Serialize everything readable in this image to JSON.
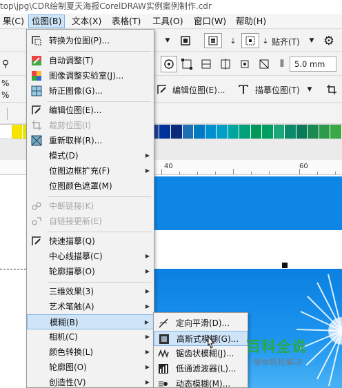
{
  "window": {
    "title": "top\\jpg\\CDR绘制夏天海报CorelDRAW实例案例制作.cdr"
  },
  "menubar": {
    "items": [
      {
        "label": "果(C)"
      },
      {
        "label": "位图(B)",
        "active": true
      },
      {
        "label": "文本(X)"
      },
      {
        "label": "表格(T)"
      },
      {
        "label": "工具(O)"
      },
      {
        "label": "窗口(W)"
      },
      {
        "label": "帮助(H)"
      }
    ]
  },
  "toolbar": {
    "snap_label": "贴齐(T)",
    "outline_width": "5.0 mm",
    "edit_bitmap_label": "编辑位图(E)...",
    "trace_bitmap_label": "描摹位图(T)",
    "percent_symbol_1": "%",
    "percent_symbol_2": "%"
  },
  "ruler": {
    "marks": [
      "40",
      "60"
    ]
  },
  "bitmap_menu": {
    "items": [
      {
        "label": "转换为位图(P)...",
        "icon": "convert-bitmap-icon"
      },
      {
        "label": "自动调整(T)",
        "icon": "auto-adjust-icon"
      },
      {
        "label": "图像调整实验室(J)...",
        "icon": "image-lab-icon"
      },
      {
        "label": "矫正图像(G)...",
        "icon": "straighten-icon"
      },
      {
        "label": "编辑位图(E)...",
        "icon": "edit-bitmap-icon"
      },
      {
        "label": "裁剪位图(I)",
        "icon": "crop-bitmap-icon",
        "disabled": true
      },
      {
        "label": "重新取样(R)...",
        "icon": "resample-icon"
      },
      {
        "label": "模式(D)",
        "submenu": true
      },
      {
        "label": "位图边框扩充(F)",
        "submenu": true
      },
      {
        "label": "位图颜色遮罩(M)"
      },
      {
        "label": "中断链接(K)",
        "icon": "break-link-icon",
        "disabled": true
      },
      {
        "label": "自链接更新(E)",
        "icon": "update-link-icon",
        "disabled": true
      },
      {
        "label": "快速描摹(Q)",
        "icon": "quick-trace-icon"
      },
      {
        "label": "中心线描摹(C)",
        "submenu": true
      },
      {
        "label": "轮廓描摹(O)",
        "submenu": true
      },
      {
        "label": "三维效果(3)",
        "submenu": true
      },
      {
        "label": "艺术笔触(A)",
        "submenu": true
      },
      {
        "label": "模糊(B)",
        "submenu": true,
        "active": true
      },
      {
        "label": "相机(C)",
        "submenu": true
      },
      {
        "label": "颜色转换(L)",
        "submenu": true
      },
      {
        "label": "轮廓图(O)",
        "submenu": true
      },
      {
        "label": "创造性(V)",
        "submenu": true
      }
    ]
  },
  "blur_submenu": {
    "items": [
      {
        "label": "定向平滑(D)...",
        "icon": "directional-smooth-icon"
      },
      {
        "label": "高斯式模糊(G)...",
        "icon": "gaussian-blur-icon",
        "hover": true
      },
      {
        "label": "锯齿状模糊(J)...",
        "icon": "jaggy-blur-icon"
      },
      {
        "label": "低通滤波器(L)...",
        "icon": "low-pass-icon"
      },
      {
        "label": "动态模糊(M)...",
        "icon": "motion-blur-icon"
      }
    ]
  },
  "watermark": {
    "title": "百科全说",
    "subtitle": "助你轻松解决"
  },
  "colors": {
    "accent_blue": "#0e86e6",
    "menu_highlight": "#cfe4f8",
    "watermark_green": "#2aa84a",
    "palette": [
      "#ffffff",
      "#f5e400",
      "#e6e600",
      "#111111",
      "#555555",
      "#777777",
      "#999999",
      "#bbbbbb",
      "#dddddd",
      "#1a1a6e",
      "#263c8f",
      "#2b4aa8",
      "#3156b8",
      "#1f3f99",
      "#003399",
      "#0b2a7a",
      "#1f6fb5",
      "#0079c1",
      "#0090d0",
      "#009fc8",
      "#00a5a0",
      "#00a07a",
      "#00995a",
      "#009e63",
      "#1aa87a",
      "#0a8a6a",
      "#0b7a58",
      "#1a8a50",
      "#2b9a48",
      "#3aa845"
    ]
  }
}
